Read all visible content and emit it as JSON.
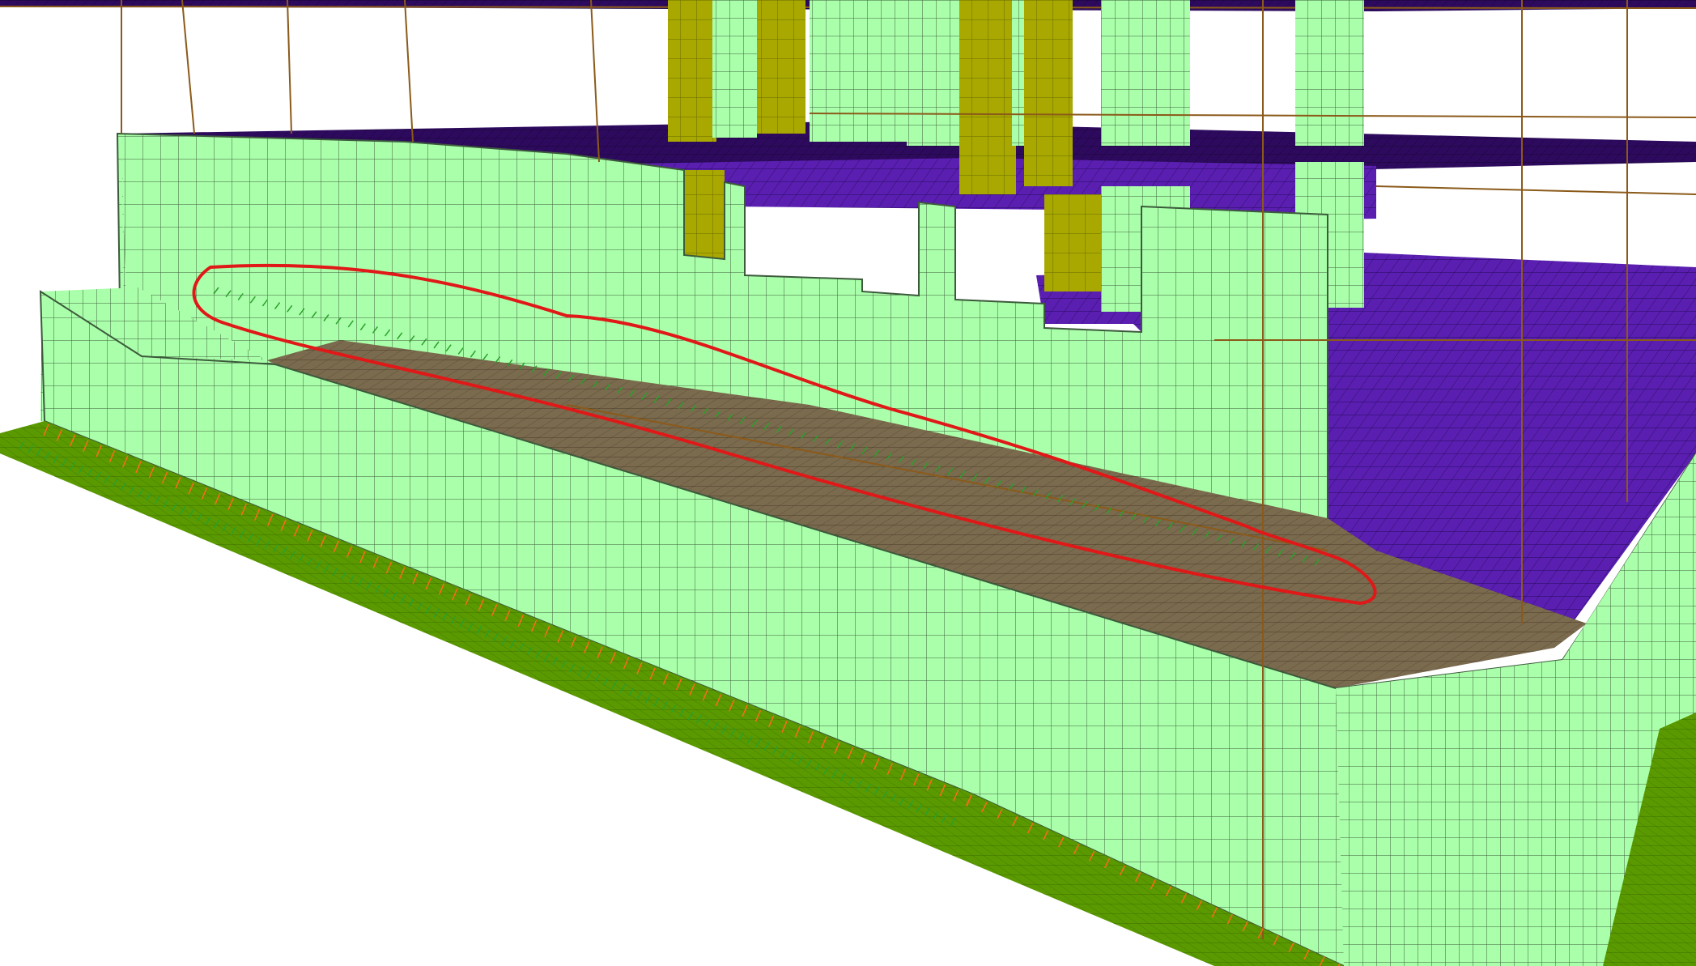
{
  "viewport": {
    "background": "#ffffff",
    "description_free": true
  },
  "materials": {
    "wall": "#aaffaa",
    "wall_edge": "#3c5a3c",
    "mesh_line": "#404040",
    "slab_top": "#2e0a5f",
    "slab_purple": "#5a1fb0",
    "slab_dark": "#1a1030",
    "ground": "#5a9a00",
    "ground_line": "#3a6a00",
    "column_olive": "#a8a800",
    "column_olive_dark": "#7a7a00",
    "floor_brown": "#7a6a4e",
    "floor_line": "#4a3c28",
    "frame_line": "#8b5a1a",
    "support_orange": "#ff6a1a",
    "support_green": "#2aa02a",
    "highlight_loop": "#e01818"
  },
  "annotation": {
    "type": "freehand-loop",
    "stroke": "#e01818"
  }
}
